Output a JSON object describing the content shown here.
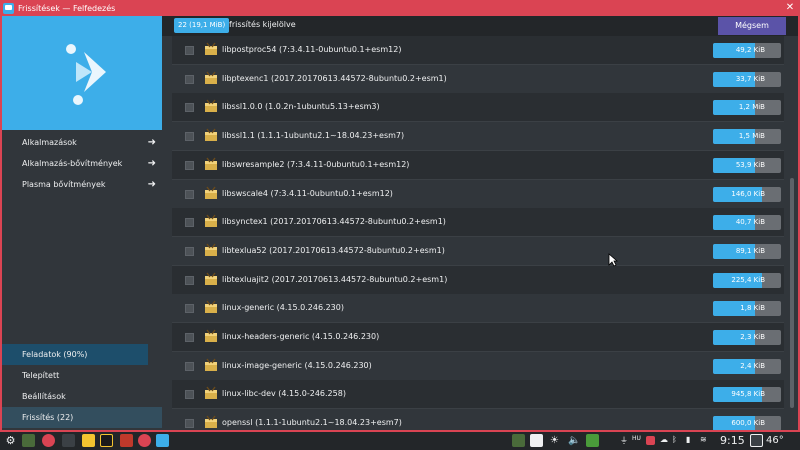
{
  "window": {
    "title": "Frissítések — Felfedezés"
  },
  "sidebar": {
    "items": [
      {
        "label": "Alkalmazások",
        "arrow": "➜"
      },
      {
        "label": "Alkalmazás-bővítmények",
        "arrow": "➜"
      },
      {
        "label": "Plasma bővítmények",
        "arrow": "➜"
      }
    ],
    "bottom": [
      {
        "label": "Feladatok (90%)",
        "progress": 0.9
      },
      {
        "label": "Telepített"
      },
      {
        "label": "Beállítások"
      },
      {
        "label": "Frissítés (22)"
      }
    ]
  },
  "topbar": {
    "badge": "22 (19,1 MiB)",
    "selected_text": "frissítés kijelölve",
    "cancel_label": "Mégsem"
  },
  "packages": [
    {
      "name": "libpostproc54 (7:3.4.11-0ubuntu0.1+esm12)",
      "size": "49,2 KiB",
      "fill": 0.62
    },
    {
      "name": "libptexenc1 (2017.20170613.44572-8ubuntu0.2+esm1)",
      "size": "33,7 KiB",
      "fill": 0.62
    },
    {
      "name": "libssl1.0.0 (1.0.2n-1ubuntu5.13+esm3)",
      "size": "1,2 MiB",
      "fill": 0.62
    },
    {
      "name": "libssl1.1 (1.1.1-1ubuntu2.1~18.04.23+esm7)",
      "size": "1,5 MiB",
      "fill": 0.62
    },
    {
      "name": "libswresample2 (7:3.4.11-0ubuntu0.1+esm12)",
      "size": "53,9 KiB",
      "fill": 0.62
    },
    {
      "name": "libswscale4 (7:3.4.11-0ubuntu0.1+esm12)",
      "size": "146,0 KiB",
      "fill": 0.72
    },
    {
      "name": "libsynctex1 (2017.20170613.44572-8ubuntu0.2+esm1)",
      "size": "40,7 KiB",
      "fill": 0.62
    },
    {
      "name": "libtexlua52 (2017.20170613.44572-8ubuntu0.2+esm1)",
      "size": "89,1 KiB",
      "fill": 0.62
    },
    {
      "name": "libtexluajit2 (2017.20170613.44572-8ubuntu0.2+esm1)",
      "size": "225,4 KiB",
      "fill": 0.72
    },
    {
      "name": "linux-generic (4.15.0.246.230)",
      "size": "1,8 KiB",
      "fill": 0.62
    },
    {
      "name": "linux-headers-generic (4.15.0.246.230)",
      "size": "2,3 KiB",
      "fill": 0.62
    },
    {
      "name": "linux-image-generic (4.15.0.246.230)",
      "size": "2,4 KiB",
      "fill": 0.62
    },
    {
      "name": "linux-libc-dev (4.15.0-246.258)",
      "size": "945,8 KiB",
      "fill": 0.72
    },
    {
      "name": "openssl (1.1.1-1ubuntu2.1~18.04.23+esm7)",
      "size": "600,0 KiB",
      "fill": 0.62
    }
  ],
  "taskbar": {
    "clock": "9:15",
    "temp": "46°",
    "tray_label": "HU"
  },
  "colors": {
    "accent": "#3daee9",
    "titlebar": "#da4453",
    "cancel": "#5b53a8"
  }
}
